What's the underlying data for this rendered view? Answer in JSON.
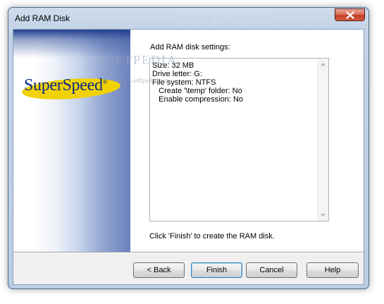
{
  "window": {
    "title": "Add RAM Disk"
  },
  "logo": {
    "text": "SuperSpeed",
    "mark": "®"
  },
  "settings": {
    "heading": "Add RAM disk settings:",
    "lines": [
      "Size: 32 MB",
      "",
      "Drive letter: G:",
      "File system: NTFS",
      "   Create '\\temp' folder: No",
      "   Enable compression: No"
    ],
    "hint": "Click 'Finish' to create the RAM disk."
  },
  "buttons": {
    "back": "< Back",
    "finish": "Finish",
    "cancel": "Cancel",
    "help": "Help"
  },
  "watermark": {
    "brand": "SOFTPEDIA",
    "url": "www.softpedia.com"
  },
  "colors": {
    "logo_blue": "#0b2a86",
    "logo_gold": "#f2d200",
    "close_red": "#c1402a"
  }
}
